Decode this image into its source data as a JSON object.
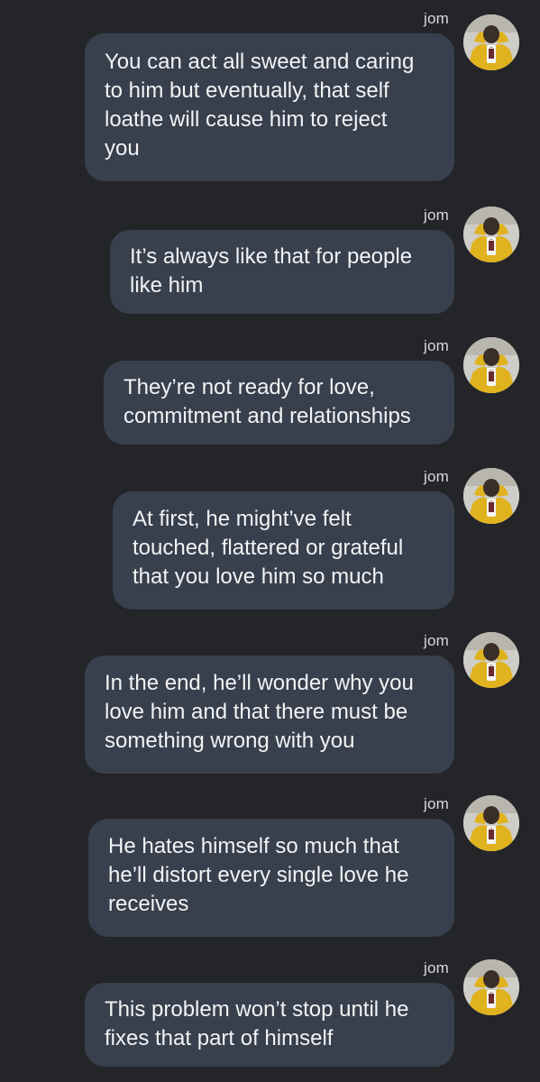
{
  "conversation": {
    "messages": [
      {
        "sender": "jom",
        "text": "You can act all sweet and caring\nto him but eventually, that self\nloathe will cause him to reject\nyou",
        "avatar_icon": "user-avatar"
      },
      {
        "sender": "jom",
        "text": "It’s always like that for people\nlike him",
        "avatar_icon": "user-avatar"
      },
      {
        "sender": "jom",
        "text": "They’re not ready for love,\ncommitment and relationships",
        "avatar_icon": "user-avatar"
      },
      {
        "sender": "jom",
        "text": "At first, he might’ve felt\ntouched, flattered or grateful\nthat you love him so much",
        "avatar_icon": "user-avatar"
      },
      {
        "sender": "jom",
        "text": "In the end, he’ll wonder why you\nlove him and that there must be\nsomething wrong with you",
        "avatar_icon": "user-avatar"
      },
      {
        "sender": "jom",
        "text": "He hates himself so much that\nhe’ll distort every single love he\nreceives",
        "avatar_icon": "user-avatar"
      },
      {
        "sender": "jom",
        "text": "This problem won’t stop until he\nfixes that part of himself",
        "avatar_icon": "user-avatar"
      }
    ]
  },
  "colors": {
    "background": "#242529",
    "bubble": "#383f4d",
    "text": "#f2f3f5",
    "avatar_accent": "#e0b21e"
  }
}
